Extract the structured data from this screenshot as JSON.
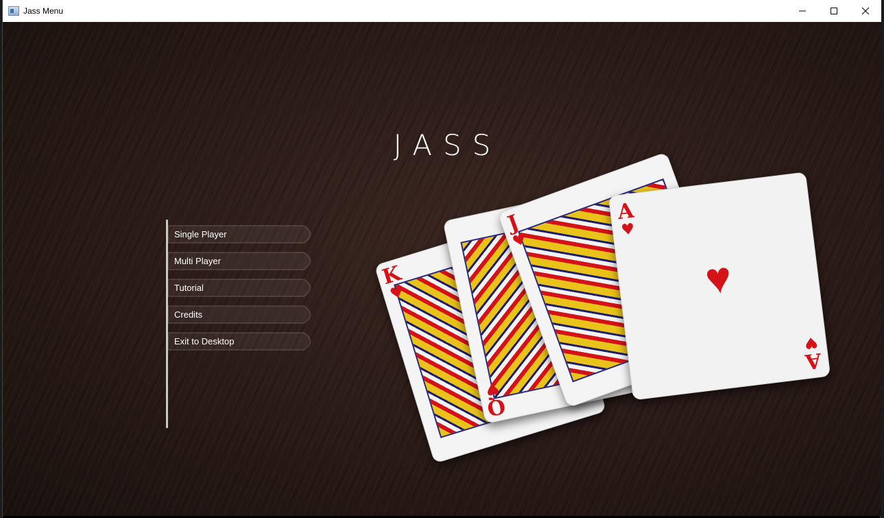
{
  "window": {
    "title": "Jass Menu",
    "controls": [
      {
        "name": "minimize-button",
        "icon": "minimize-icon"
      },
      {
        "name": "maximize-button",
        "icon": "maximize-icon"
      },
      {
        "name": "close-button",
        "icon": "close-icon"
      }
    ]
  },
  "game": {
    "title": "JASS"
  },
  "menu": {
    "items": [
      {
        "label": "Single Player"
      },
      {
        "label": "Multi Player"
      },
      {
        "label": "Tutorial"
      },
      {
        "label": "Credits"
      },
      {
        "label": "Exit to Desktop"
      }
    ]
  },
  "cards": {
    "suit_symbol": "♥",
    "suit_color": "#d41218",
    "hand": [
      {
        "rank": "K",
        "suit": "hearts"
      },
      {
        "rank": "Q",
        "suit": "hearts"
      },
      {
        "rank": "J",
        "suit": "hearts"
      },
      {
        "rank": "A",
        "suit": "hearts"
      }
    ]
  },
  "colors": {
    "table": "#2c1c18",
    "menu_text": "#ffffff",
    "menu_rule": "#c9c9c9"
  }
}
